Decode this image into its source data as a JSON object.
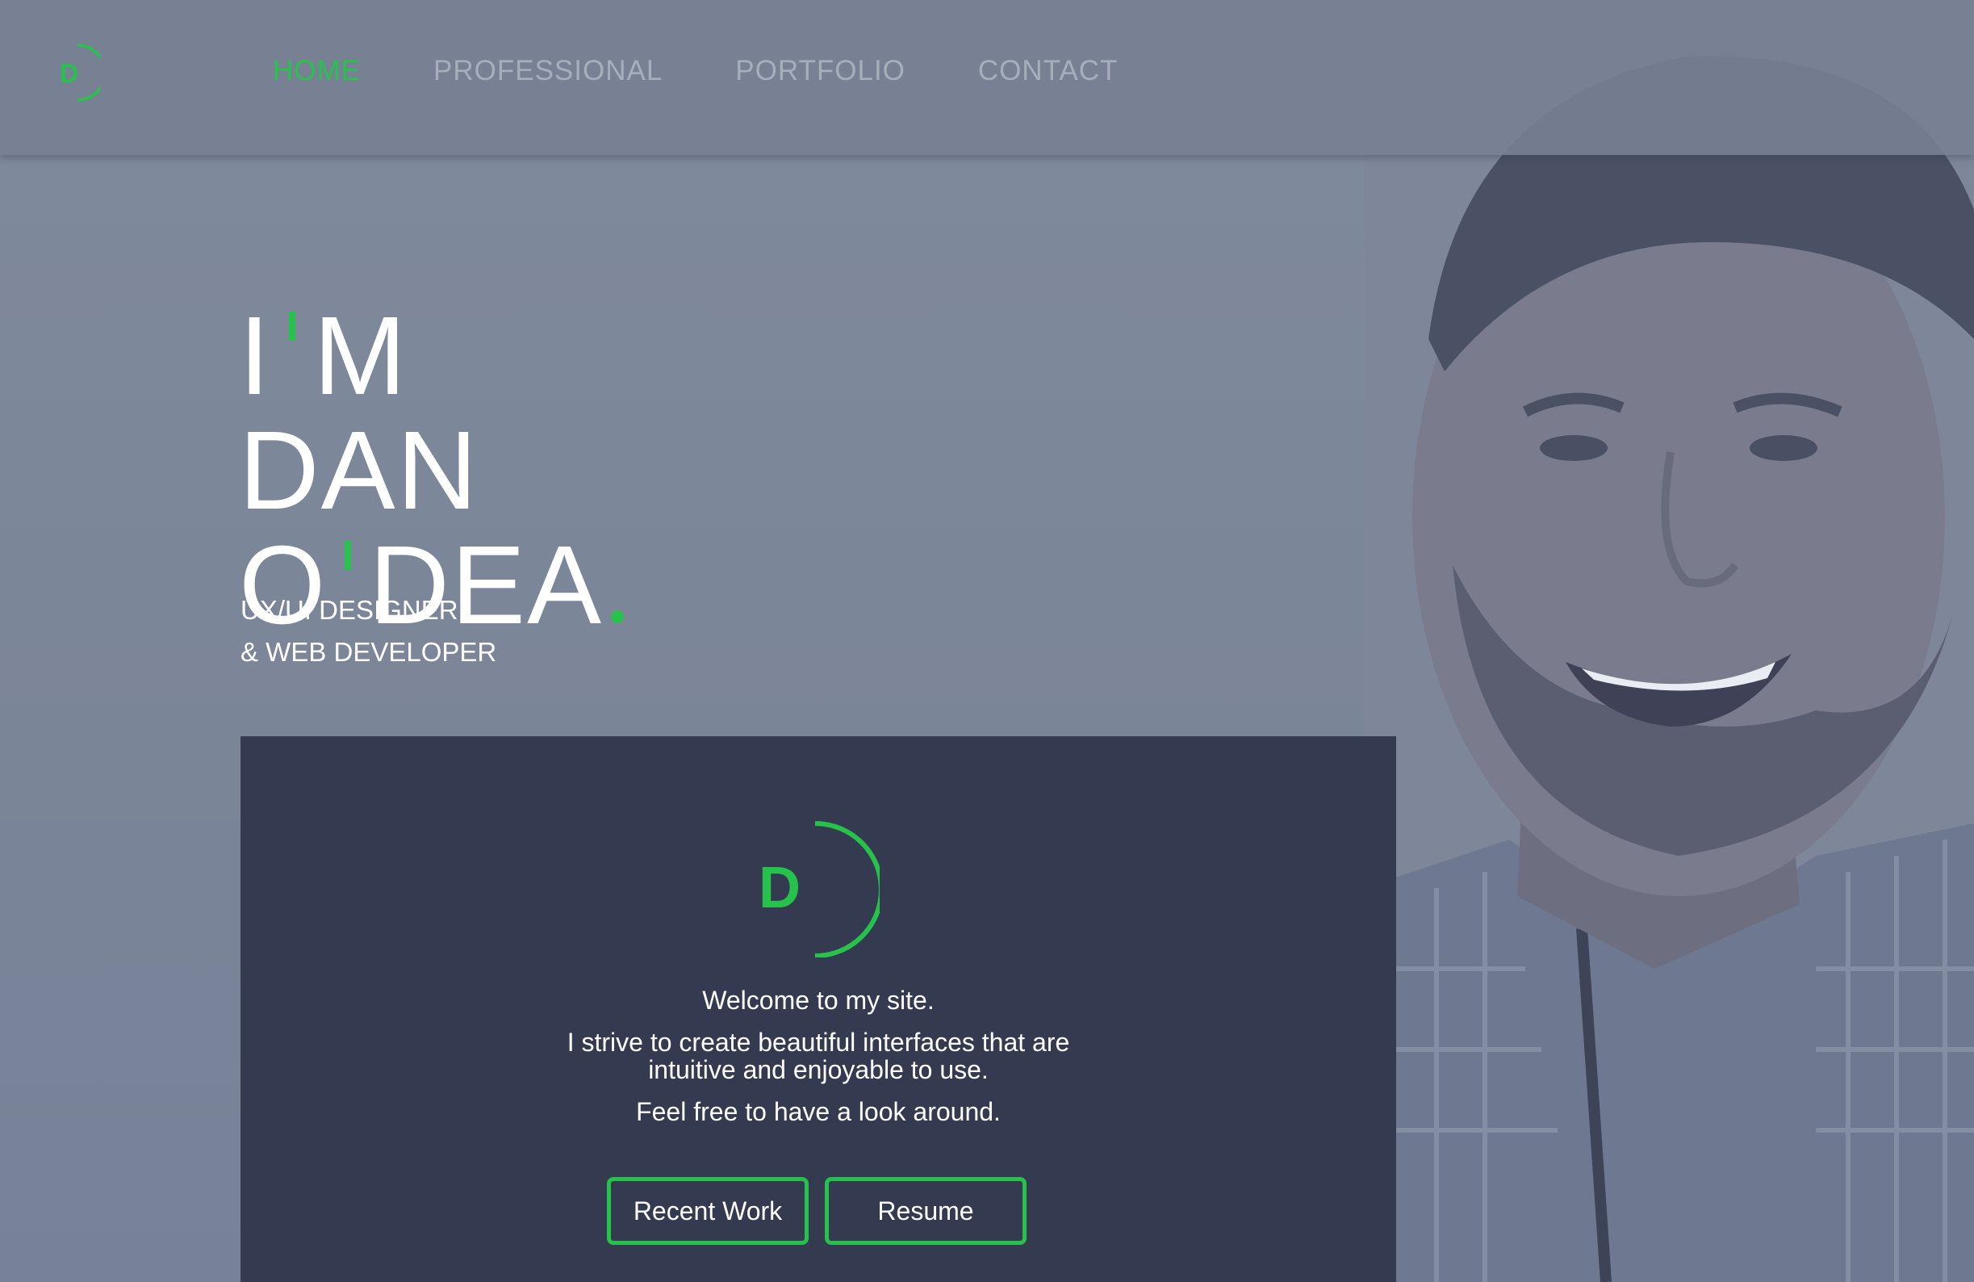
{
  "colors": {
    "accent": "#26c24b",
    "card": "#343b50",
    "nav_inactive": "#a7aebb",
    "overlay": "#7d8799"
  },
  "header": {
    "logo_letter": "D",
    "nav": [
      {
        "label": "HOME",
        "active": true
      },
      {
        "label": "PROFESSIONAL",
        "active": false
      },
      {
        "label": "PORTFOLIO",
        "active": false
      },
      {
        "label": "CONTACT",
        "active": false
      }
    ]
  },
  "hero": {
    "line1_a": "I",
    "line1_b": "M",
    "line2": "DAN",
    "line3_a": "O",
    "line3_b": "DEA",
    "subtitle_1": "UX/UI DESIGNER",
    "subtitle_2": "& WEB DEVELOPER"
  },
  "card": {
    "logo_letter": "D",
    "welcome": "Welcome to my site.",
    "body": "I strive to create beautiful interfaces that are intuitive and enjoyable to use.",
    "cta_text": "Feel free to have a look around.",
    "btn_recent": "Recent Work",
    "btn_resume": "Resume"
  },
  "icons": [
    "logo-mark-icon"
  ]
}
